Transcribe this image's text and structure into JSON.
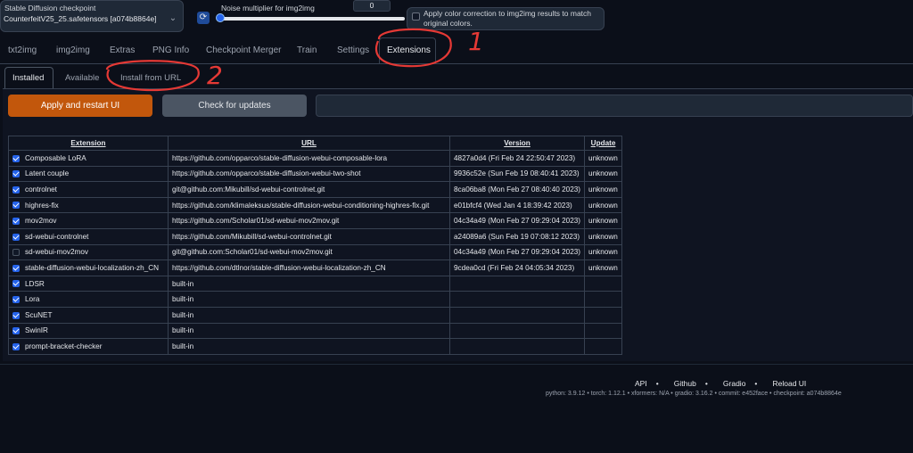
{
  "checkpoint": {
    "label": "Stable Diffusion checkpoint",
    "value": "CounterfeitV25_25.safetensors [a074b8864e]"
  },
  "noise": {
    "label": "Noise multiplier for img2img",
    "value": "0",
    "fraction": 0.0
  },
  "color_correction": {
    "label": "Apply color correction to img2img results to match original colors.",
    "checked": false
  },
  "tabs": [
    "txt2img",
    "img2img",
    "Extras",
    "PNG Info",
    "Checkpoint Merger",
    "Train",
    "Settings",
    "Extensions"
  ],
  "active_tab": "Extensions",
  "sub_tabs": [
    "Installed",
    "Available",
    "Install from URL"
  ],
  "active_sub_tab": "Installed",
  "buttons": {
    "apply": "Apply and restart UI",
    "check": "Check for updates"
  },
  "table": {
    "headers": [
      "Extension",
      "URL",
      "Version",
      "Update"
    ],
    "rows": [
      {
        "checked": true,
        "name": "Composable LoRA",
        "url": "https://github.com/opparco/stable-diffusion-webui-composable-lora",
        "version": "4827a0d4 (Fri Feb 24 22:50:47 2023)",
        "update": "unknown"
      },
      {
        "checked": true,
        "name": "Latent couple",
        "url": "https://github.com/opparco/stable-diffusion-webui-two-shot",
        "version": "9936c52e (Sun Feb 19 08:40:41 2023)",
        "update": "unknown"
      },
      {
        "checked": true,
        "name": "controlnet",
        "url": "git@github.com:Mikubill/sd-webui-controlnet.git",
        "version": "8ca06ba8 (Mon Feb 27 08:40:40 2023)",
        "update": "unknown"
      },
      {
        "checked": true,
        "name": "highres-fix",
        "url": "https://github.com/klimaleksus/stable-diffusion-webui-conditioning-highres-fix.git",
        "version": "e01bfcf4 (Wed Jan 4 18:39:42 2023)",
        "update": "unknown"
      },
      {
        "checked": true,
        "name": "mov2mov",
        "url": "https://github.com/Scholar01/sd-webui-mov2mov.git",
        "version": "04c34a49 (Mon Feb 27 09:29:04 2023)",
        "update": "unknown"
      },
      {
        "checked": true,
        "name": "sd-webui-controlnet",
        "url": "https://github.com/Mikubill/sd-webui-controlnet.git",
        "version": "a24089a6 (Sun Feb 19 07:08:12 2023)",
        "update": "unknown"
      },
      {
        "checked": false,
        "name": "sd-webui-mov2mov",
        "url": "git@github.com:Scholar01/sd-webui-mov2mov.git",
        "version": "04c34a49 (Mon Feb 27 09:29:04 2023)",
        "update": "unknown"
      },
      {
        "checked": true,
        "name": "stable-diffusion-webui-localization-zh_CN",
        "url": "https://github.com/dtlnor/stable-diffusion-webui-localization-zh_CN",
        "version": "9cdea0cd (Fri Feb 24 04:05:34 2023)",
        "update": "unknown"
      },
      {
        "checked": true,
        "name": "LDSR",
        "url": "built-in",
        "version": "",
        "update": ""
      },
      {
        "checked": true,
        "name": "Lora",
        "url": "built-in",
        "version": "",
        "update": ""
      },
      {
        "checked": true,
        "name": "ScuNET",
        "url": "built-in",
        "version": "",
        "update": ""
      },
      {
        "checked": true,
        "name": "SwinIR",
        "url": "built-in",
        "version": "",
        "update": ""
      },
      {
        "checked": true,
        "name": "prompt-bracket-checker",
        "url": "built-in",
        "version": "",
        "update": ""
      }
    ]
  },
  "footer": {
    "links": [
      "API",
      "Github",
      "Gradio",
      "Reload UI"
    ],
    "info": "python: 3.9.12  •  torch: 1.12.1  •  xformers: N/A  •  gradio: 3.16.2  •  commit: e452face  •  checkpoint: a074b8864e"
  },
  "annotations": {
    "one": "1",
    "two": "2",
    "color": "#e53935"
  }
}
